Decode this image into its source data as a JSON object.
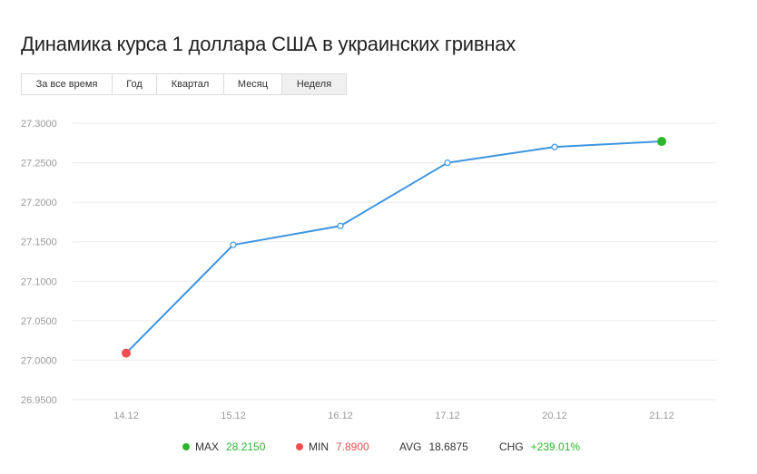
{
  "title": "Динамика курса 1 доллара США в украинских гривнах",
  "tabs": [
    {
      "label": "За все время",
      "active": false
    },
    {
      "label": "Год",
      "active": false
    },
    {
      "label": "Квартал",
      "active": false
    },
    {
      "label": "Месяц",
      "active": false
    },
    {
      "label": "Неделя",
      "active": true
    }
  ],
  "chart_data": {
    "type": "line",
    "categories": [
      "14.12",
      "15.12",
      "16.12",
      "17.12",
      "20.12",
      "21.12"
    ],
    "values": [
      27.009,
      27.146,
      27.17,
      27.25,
      27.27,
      27.277
    ],
    "ylim": [
      26.95,
      27.3
    ],
    "yticks": [
      "27.3000",
      "27.2500",
      "27.2000",
      "27.1500",
      "27.1000",
      "27.0500",
      "27.0000",
      "26.9500"
    ],
    "grid": true,
    "line_color": "#3d94e0",
    "max_point_color": "#2db52d",
    "min_point_color": "#f04f4f"
  },
  "stats": {
    "max": {
      "label": "MAX",
      "value": "28.2150",
      "color": "#2db52d",
      "value_color": "#2db52d"
    },
    "min": {
      "label": "MIN",
      "value": "7.8900",
      "color": "#f04f4f",
      "value_color": "#f04f4f"
    },
    "avg": {
      "label": "AVG",
      "value": "18.6875",
      "value_color": "#333333"
    },
    "chg": {
      "label": "CHG",
      "value": "+239.01%",
      "value_color": "#2db52d"
    }
  }
}
